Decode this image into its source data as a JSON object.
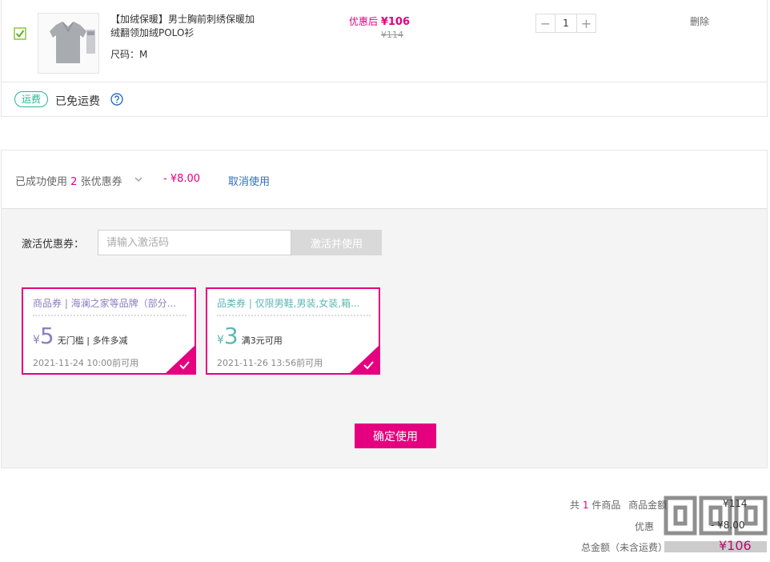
{
  "product": {
    "title": "【加绒保暖】男士胸前刺绣保暖加绒翻领加绒POLO衫",
    "size_label": "尺码：M",
    "price_after_label": "优惠后",
    "price_after": "¥106",
    "price_original": "¥114",
    "quantity": "1",
    "delete_label": "删除"
  },
  "shipping": {
    "tag": "运费",
    "text": "已免运费"
  },
  "coupon_summary": {
    "prefix": "已成功使用",
    "count": "2",
    "suffix": "张优惠券",
    "discount": "- ¥8.00",
    "cancel_label": "取消使用"
  },
  "activate": {
    "label": "激活优惠券：",
    "placeholder": "请输入激活码",
    "button": "激活并使用"
  },
  "coupons": [
    {
      "title": "商品券 | 海澜之家等品牌（部分...",
      "currency": "¥",
      "amount": "5",
      "rule": "无门槛 | 多件多减",
      "expire": "2021-11-24 10:00前可用"
    },
    {
      "title": "品类券 | 仅限男鞋,男装,女装,箱...",
      "currency": "¥",
      "amount": "3",
      "rule": "满3元可用",
      "expire": "2021-11-26 13:56前可用"
    }
  ],
  "confirm_label": "确定使用",
  "summary": {
    "count_prefix": "共",
    "count": "1",
    "count_suffix": "件商品",
    "goods_label": "商品金额",
    "goods_value": "¥114",
    "discount_label": "优惠",
    "discount_value": "- ¥8.00",
    "total_label": "总金额（未含运费）",
    "total_value": "¥106"
  },
  "colors": {
    "accent": "#e4007f",
    "coupon_text_1": "#8a7fc0",
    "coupon_text_2": "#5fb6b6",
    "shipping_green": "#29b392",
    "link_blue": "#2f6fbf"
  }
}
